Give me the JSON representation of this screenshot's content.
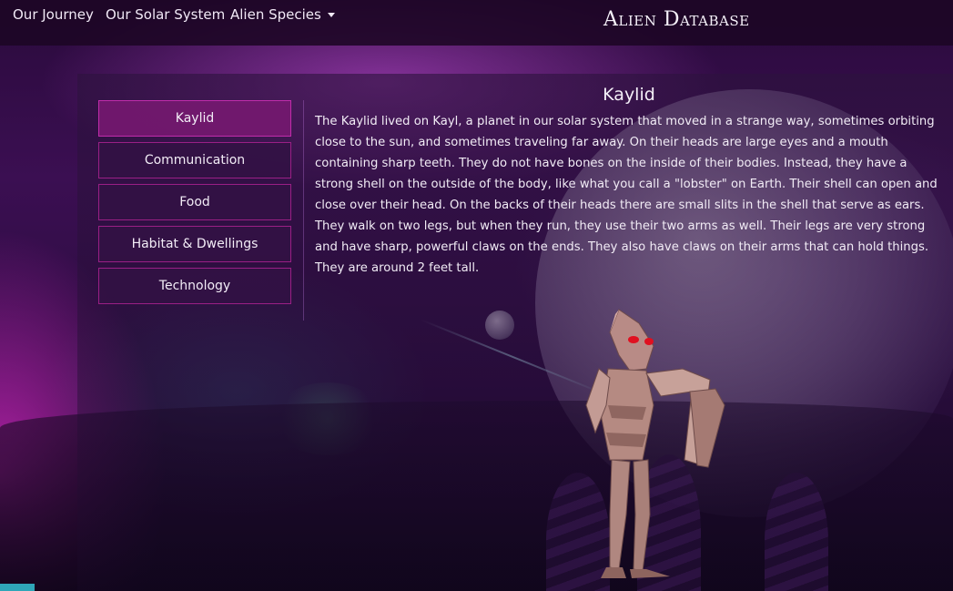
{
  "nav": {
    "links": [
      {
        "label": "Our Journey"
      },
      {
        "label": "Our Solar System"
      },
      {
        "label": "Alien Species"
      }
    ],
    "brand": "Alien Database"
  },
  "sidebar": {
    "items": [
      {
        "label": "Kaylid",
        "active": true
      },
      {
        "label": "Communication",
        "active": false
      },
      {
        "label": "Food",
        "active": false
      },
      {
        "label": "Habitat & Dwellings",
        "active": false
      },
      {
        "label": "Technology",
        "active": false
      }
    ]
  },
  "content": {
    "title": "Kaylid",
    "body": "The Kaylid lived on Kayl, a planet in our solar system that moved in a strange way, sometimes orbiting close to the sun, and sometimes traveling far away. On their heads are large eyes and a mouth containing sharp teeth. They do not have bones on the inside of their bodies. Instead, they have a strong shell on the outside of the body, like what you call a \"lobster\" on Earth. Their shell can open and close over their head. On the backs of their heads there are small slits in the shell that serve as ears. They walk on two legs, but when they run, they use their two arms as well. Their legs are very strong and have sharp, powerful claws on the ends. They also have claws on their arms that can hold things. They are around 2 feet tall."
  },
  "icons": {
    "dropdown": "caret-down-icon"
  },
  "colors": {
    "accent_border": "#9a1f86",
    "active_button": "#761870",
    "background": "#2a0a3c"
  }
}
